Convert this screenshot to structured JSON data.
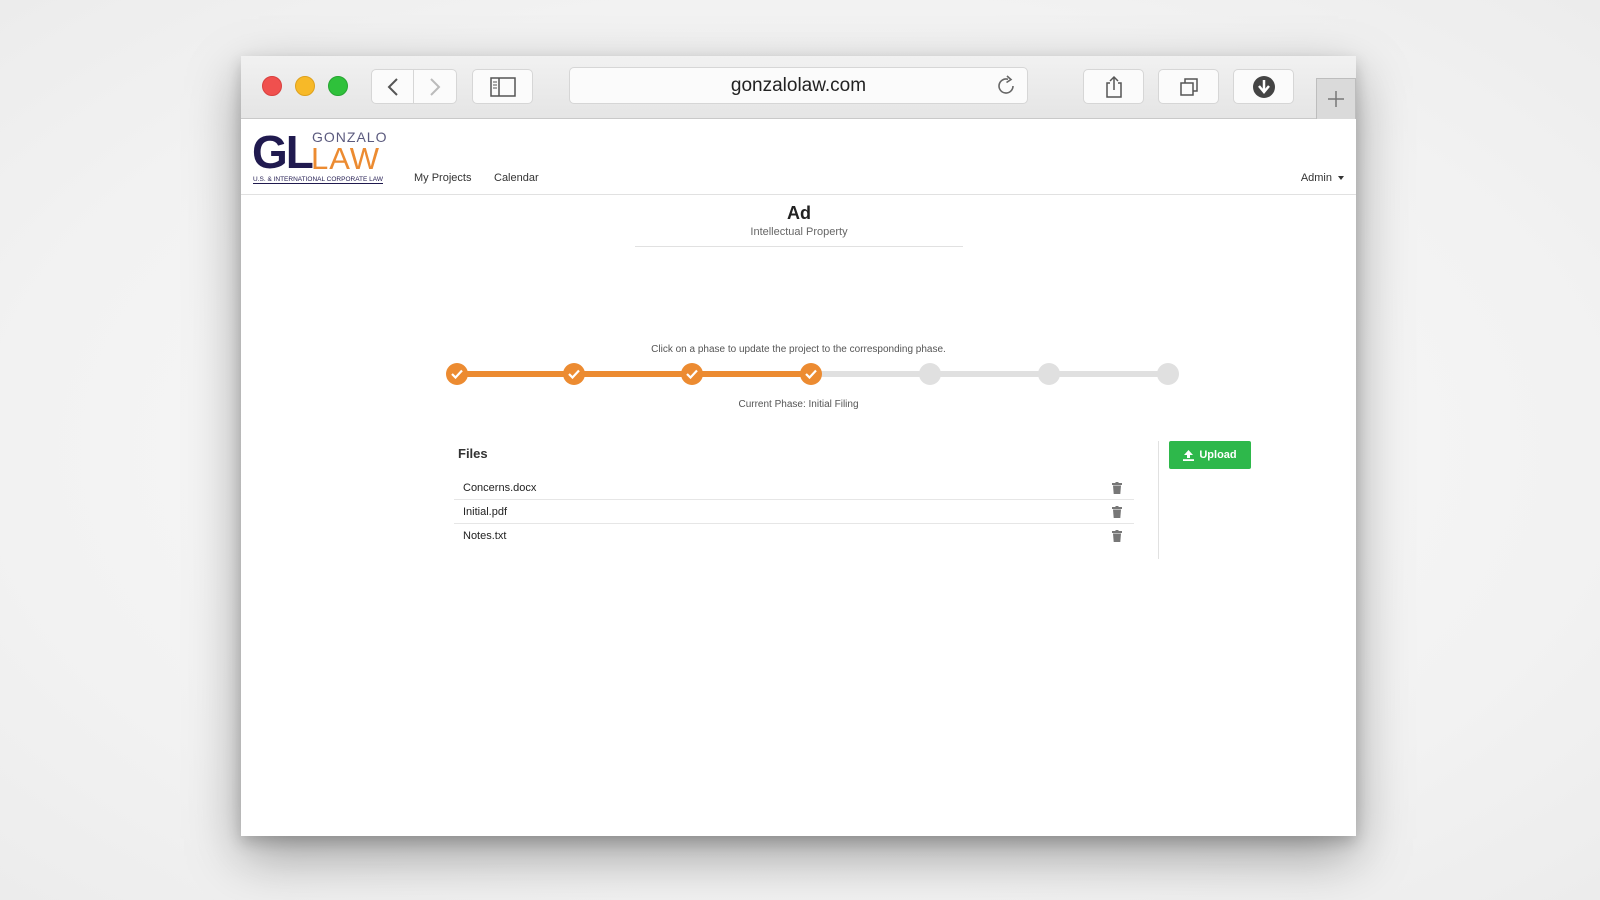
{
  "browser": {
    "url": "gonzalolaw.com",
    "icons": [
      "back-icon",
      "forward-icon",
      "sidebar-icon",
      "reload-icon",
      "share-icon",
      "tabs-icon",
      "download-icon",
      "plus-icon"
    ]
  },
  "logo": {
    "mark": "GL",
    "word_top": "GONZALO",
    "word_bottom": "LAW",
    "tagline": "U.S. & INTERNATIONAL CORPORATE LAW"
  },
  "nav": {
    "items": [
      "My Projects",
      "Calendar"
    ],
    "user": "Admin"
  },
  "project": {
    "title": "Ad",
    "category": "Intellectual Property"
  },
  "phases": {
    "hint": "Click on a phase to update the project to the corresponding phase.",
    "total": 7,
    "completed": 4,
    "current_label": "Current Phase: Initial Filing"
  },
  "files": {
    "heading": "Files",
    "items": [
      {
        "name": "Concerns.docx"
      },
      {
        "name": "Initial.pdf"
      },
      {
        "name": "Notes.txt"
      }
    ]
  },
  "upload": {
    "label": "Upload"
  },
  "colors": {
    "accent_orange": "#ec8b31",
    "brand_navy": "#201a4f",
    "upload_green": "#2eb84b",
    "inactive_gray": "#e0e0e0"
  }
}
